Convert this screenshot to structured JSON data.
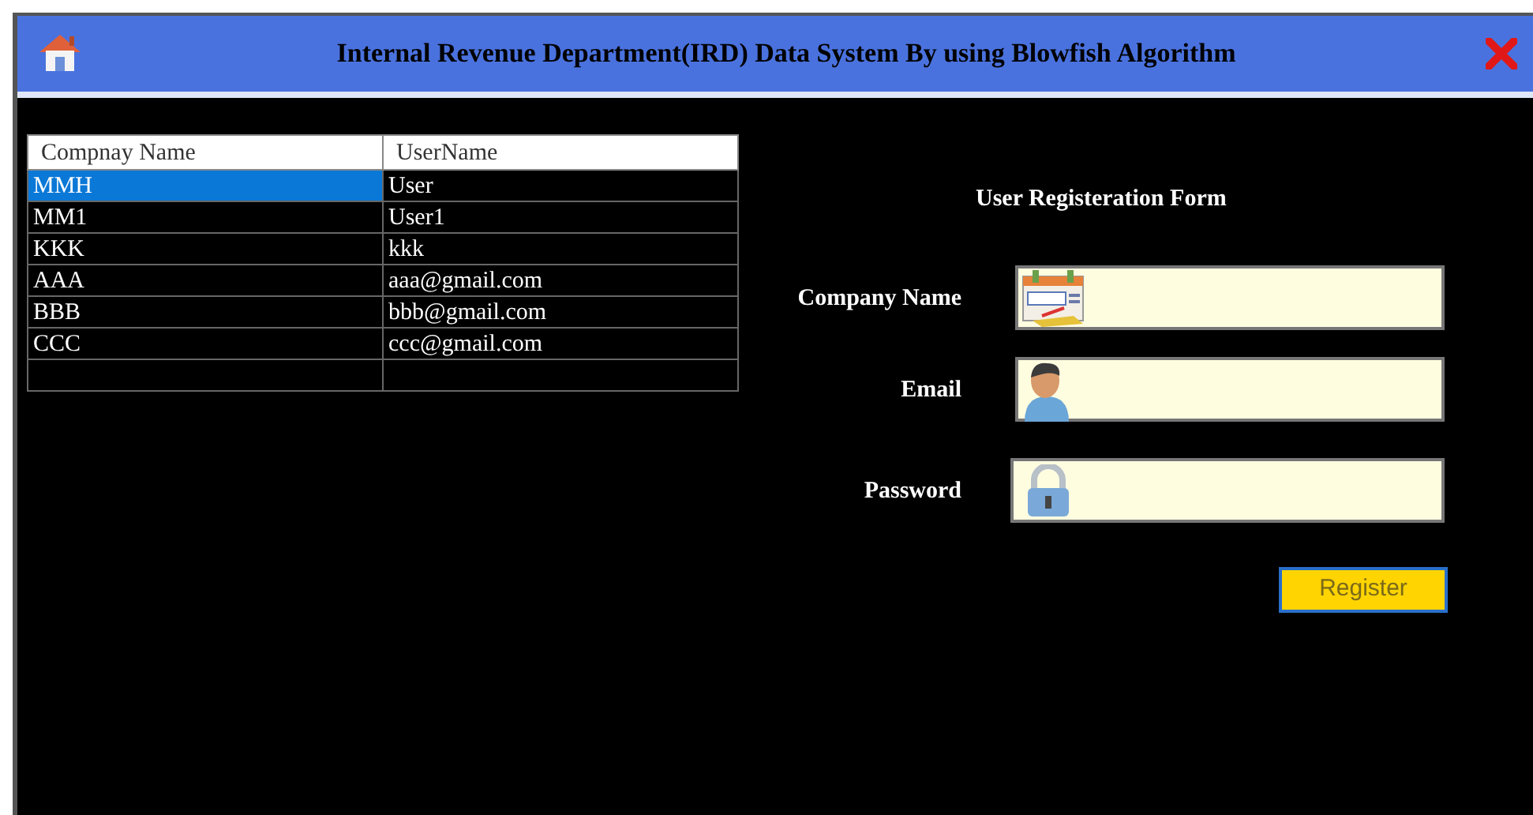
{
  "window": {
    "title": "Internal Revenue Department(IRD) Data System By using Blowfish Algorithm"
  },
  "table": {
    "columns": [
      "Compnay Name",
      "UserName"
    ],
    "rows": [
      {
        "cells": [
          "MMH",
          "User"
        ],
        "selected": true
      },
      {
        "cells": [
          "MM1",
          "User1"
        ],
        "selected": false
      },
      {
        "cells": [
          "KKK",
          "kkk"
        ],
        "selected": false
      },
      {
        "cells": [
          "AAA",
          "aaa@gmail.com"
        ],
        "selected": false
      },
      {
        "cells": [
          "BBB",
          "bbb@gmail.com"
        ],
        "selected": false
      },
      {
        "cells": [
          "CCC",
          "ccc@gmail.com"
        ],
        "selected": false
      }
    ]
  },
  "form": {
    "title": "User Registeration Form",
    "fields": [
      {
        "label": "Company Name",
        "kind": "card"
      },
      {
        "label": "Email",
        "kind": "user"
      },
      {
        "label": "Password",
        "kind": "lock"
      }
    ],
    "button": "Register"
  }
}
